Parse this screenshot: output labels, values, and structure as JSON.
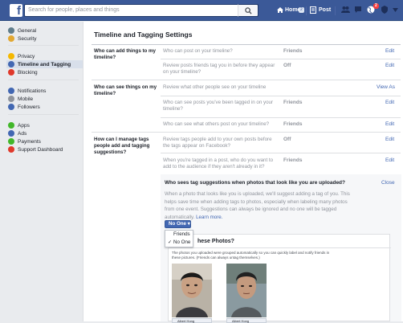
{
  "topbar": {
    "search_placeholder": "Search for people, places and things",
    "home_label": "Home",
    "home_badge": "2",
    "post_label": "Post",
    "notifications_badge": "2"
  },
  "sidebar": {
    "items": [
      {
        "label": "General",
        "color": "#607d8b"
      },
      {
        "label": "Security",
        "color": "#e2a832"
      },
      {
        "label": "Privacy",
        "color": "#f5b800"
      },
      {
        "label": "Timeline and Tagging",
        "color": "#4267b2"
      },
      {
        "label": "Blocking",
        "color": "#e0392b"
      },
      {
        "label": "Notifications",
        "color": "#4267b2"
      },
      {
        "label": "Mobile",
        "color": "#90949c"
      },
      {
        "label": "Followers",
        "color": "#4267b2"
      },
      {
        "label": "Apps",
        "color": "#42b72a"
      },
      {
        "label": "Ads",
        "color": "#4267b2"
      },
      {
        "label": "Payments",
        "color": "#42b72a"
      },
      {
        "label": "Support Dashboard",
        "color": "#e0392b"
      }
    ]
  },
  "main": {
    "title": "Timeline and Tagging Settings",
    "sections": [
      {
        "label": "Who can add things to my timeline?",
        "rows": [
          {
            "question": "Who can post on your timeline?",
            "value": "Friends",
            "action": "Edit"
          },
          {
            "question": "Review posts friends tag you in before they appear on your timeline?",
            "value": "Off",
            "action": "Edit"
          }
        ]
      },
      {
        "label": "Who can see things on my timeline?",
        "rows": [
          {
            "question": "Review what other people see on your timeline",
            "value": "",
            "action": "View As"
          },
          {
            "question": "Who can see posts you've been tagged in on your timeline?",
            "value": "Friends",
            "action": "Edit"
          },
          {
            "question": "Who can see what others post on your timeline?",
            "value": "Friends",
            "action": "Edit"
          }
        ]
      },
      {
        "label": "How can I manage tags people add and tagging suggestions?",
        "rows": [
          {
            "question": "Review tags people add to your own posts before the tags appear on Facebook?",
            "value": "Off",
            "action": "Edit"
          },
          {
            "question": "When you're tagged in a post, who do you want to add to the audience if they aren't already in it?",
            "value": "Friends",
            "action": "Edit"
          }
        ]
      }
    ],
    "panel": {
      "title": "Who sees tag suggestions when photos that look like you are uploaded?",
      "close": "Close",
      "description": "When a photo that looks like you is uploaded, we'll suggest adding a tag of you. This helps save time when adding tags to photos, especially when labeling many photos from one event. Suggestions can always be ignored and no one will be tagged automatically.",
      "learn_more": "Learn more.",
      "dropdown": {
        "selected": "No One",
        "options": [
          "Friends",
          "No One"
        ]
      },
      "preview": {
        "title_suffix": "hese Photos?",
        "text": "The photos you uploaded were grouped automatically so you can quickly label and notify friends in these pictures. (Friends can always untag themselves.)",
        "tags": [
          "Albert Hong",
          "Albert Hong"
        ]
      }
    }
  }
}
